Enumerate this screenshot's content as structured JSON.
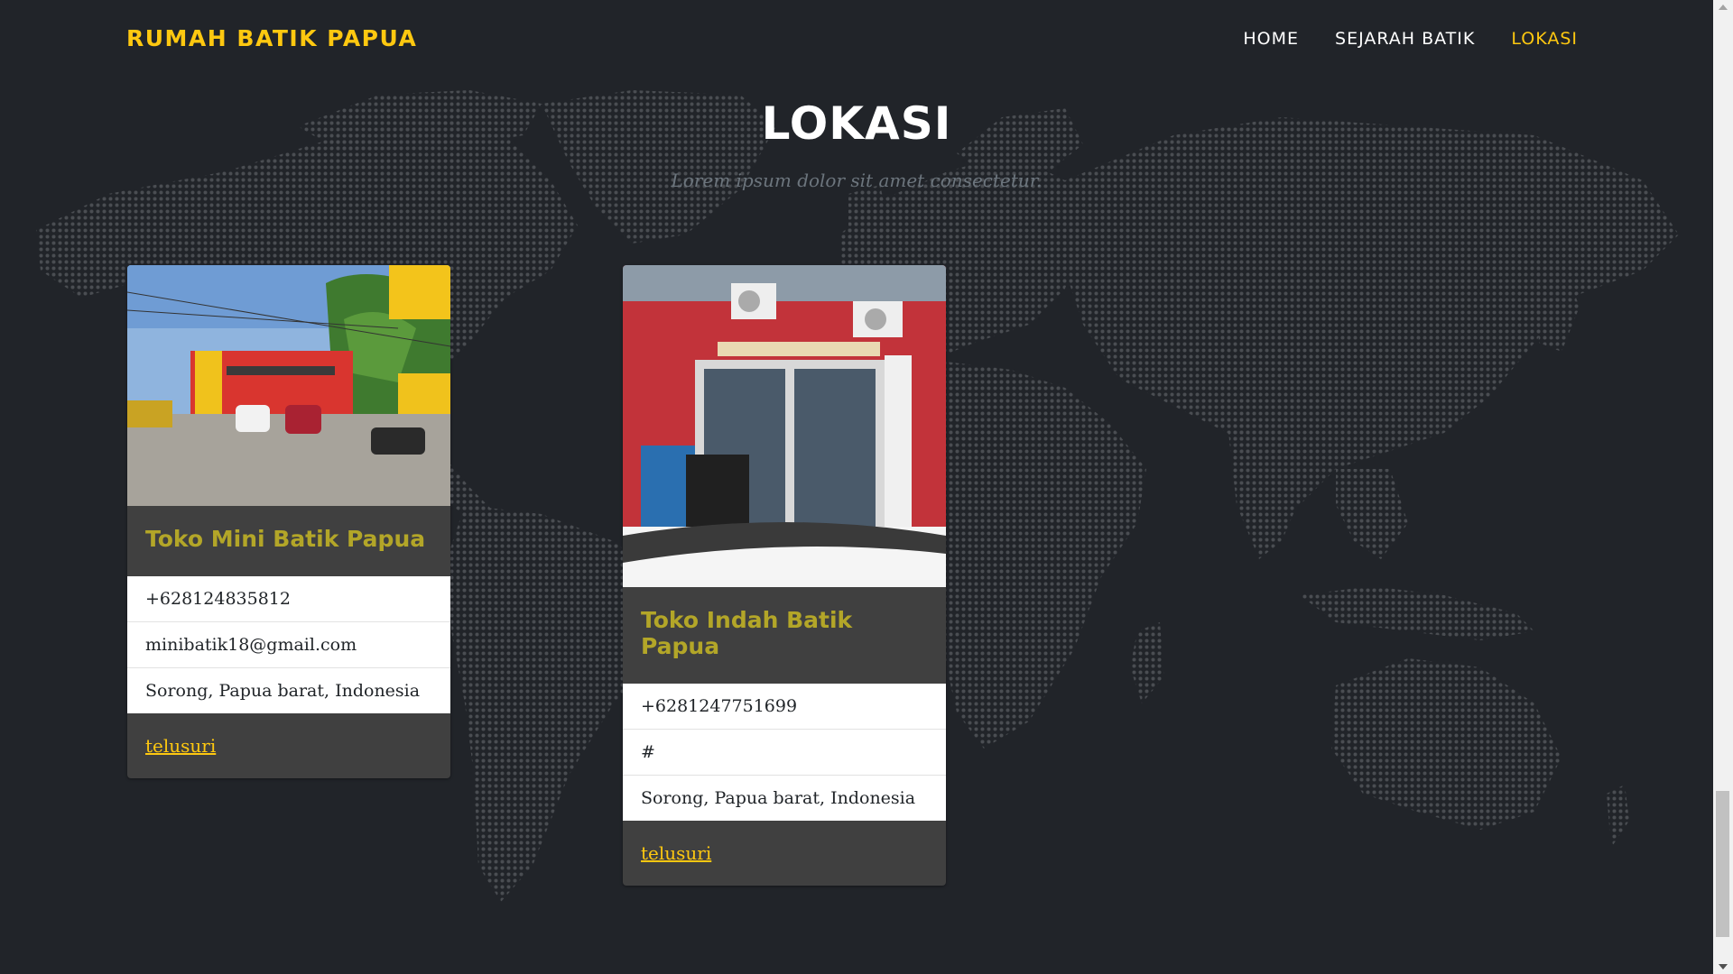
{
  "brand": "RUMAH BATIK PAPUA",
  "nav": {
    "items": [
      {
        "label": "HOME",
        "active": false
      },
      {
        "label": "SEJARAH BATIK",
        "active": false
      },
      {
        "label": "LOKASI",
        "active": true
      }
    ]
  },
  "section": {
    "title": "LOKASI",
    "subtitle": "Lorem ipsum dolor sit amet consectetur."
  },
  "cards": [
    {
      "title": "Toko Mini Batik Papua",
      "image": "store-front-photo",
      "info": [
        "+628124835812",
        "minibatik18@gmail.com",
        "Sorong, Papua barat, Indonesia"
      ],
      "link": "telusuri"
    },
    {
      "title": "Toko Indah Batik Papua",
      "image": "store-front-photo",
      "info": [
        "+6281247751699",
        "#",
        "Sorong, Papua barat, Indonesia"
      ],
      "link": "telusuri"
    }
  ],
  "colors": {
    "background": "#212429",
    "accent": "#fec810",
    "card_title": "#b3a628",
    "card_bg": "#404040",
    "map_dots": "#4a4d52"
  },
  "background_graphic": "world-map-dots"
}
